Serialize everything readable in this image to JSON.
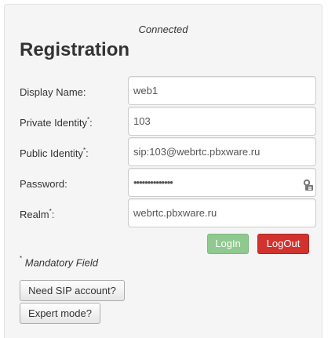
{
  "status": "Connected",
  "title": "Registration",
  "form": {
    "display_name": {
      "label": "Display Name:",
      "value": "web1",
      "required": false
    },
    "private_identity": {
      "label": "Private Identity",
      "suffix": ":",
      "value": "103",
      "required": true
    },
    "public_identity": {
      "label": "Public Identity",
      "suffix": ":",
      "value": "sip:103@webrtc.pbxware.ru",
      "required": true
    },
    "password": {
      "label": "Password:",
      "value": "••••••••••••••",
      "required": false
    },
    "realm": {
      "label": "Realm",
      "suffix": ":",
      "value": "webrtc.pbxware.ru",
      "required": true
    }
  },
  "required_marker": "*",
  "buttons": {
    "login": "LogIn",
    "logout": "LogOut",
    "need_sip_account": "Need SIP account?",
    "expert_mode": "Expert mode?"
  },
  "mandatory_note": "Mandatory Field",
  "icons": {
    "password_manager": "key-icon"
  },
  "colors": {
    "login_button": "#8fc98f",
    "logout_button": "#d2322d",
    "panel_background": "#f5f5f5"
  }
}
